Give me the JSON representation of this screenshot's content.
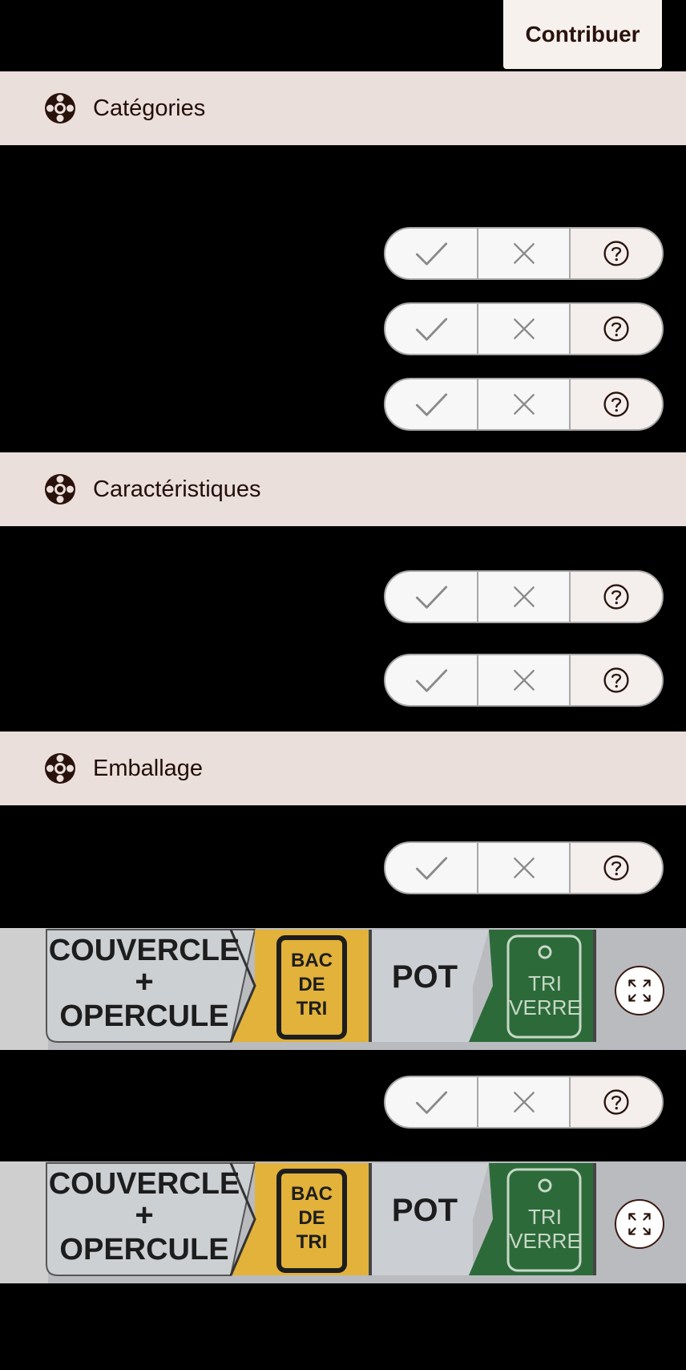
{
  "header": {
    "contribute_label": "Contribuer"
  },
  "sections": [
    {
      "title": "Catégories",
      "icon": "lifebuoy-icon"
    },
    {
      "title": "Caractéristiques",
      "icon": "lifebuoy-icon"
    },
    {
      "title": "Emballage",
      "icon": "lifebuoy-icon"
    }
  ],
  "answer_controls": {
    "yes_icon": "check-icon",
    "no_icon": "cross-icon",
    "unknown_icon": "question-icon"
  },
  "packaging_label": {
    "part1_line1": "COUVERCLE",
    "part1_line2": "+",
    "part1_line3": "OPERCULE",
    "bin_line1": "BAC",
    "bin_line2": "DE",
    "bin_line3": "TRI",
    "part2": "POT",
    "glass_line1": "TRI",
    "glass_line2": "VERRE"
  },
  "colors": {
    "header_bg": "#ebdfdb",
    "accent_dark": "#2a120c",
    "yellow": "#e2b23a",
    "green": "#2d6a3a"
  }
}
